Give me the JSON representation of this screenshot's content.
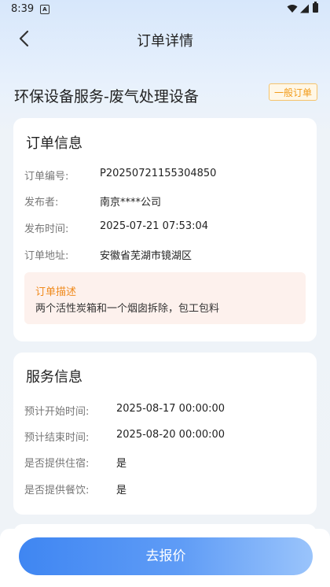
{
  "status_bar": {
    "time": "8:39",
    "app_icon": "A"
  },
  "header": {
    "title": "订单详情",
    "back_icon": "chevron-left-icon"
  },
  "order": {
    "title": "环保设备服务-废气处理设备",
    "tag": "一般订单"
  },
  "order_info": {
    "section_title": "订单信息",
    "rows": [
      {
        "label": "订单编号:",
        "value": "P20250721155304850"
      },
      {
        "label": "发布者:",
        "value": "南京****公司"
      },
      {
        "label": "发布时间:",
        "value": "2025-07-21 07:53:04"
      },
      {
        "label": "订单地址:",
        "value": "安徽省芜湖市镜湖区"
      }
    ],
    "description": {
      "title": "订单描述",
      "text": "两个活性炭箱和一个烟囱拆除，包工包料"
    }
  },
  "service_info": {
    "section_title": "服务信息",
    "rows": [
      {
        "label": "预计开始时间:",
        "value": "2025-08-17 00:00:00"
      },
      {
        "label": "预计结束时间:",
        "value": "2025-08-20 00:00:00"
      },
      {
        "label": "是否提供住宿:",
        "value": "是"
      },
      {
        "label": "是否提供餐饮:",
        "value": "是"
      }
    ]
  },
  "actions": {
    "quote_button": "去报价"
  },
  "colors": {
    "accent": "#3f86f2",
    "tag_orange": "#f29b18",
    "desc_bg": "#fdf1ed"
  }
}
